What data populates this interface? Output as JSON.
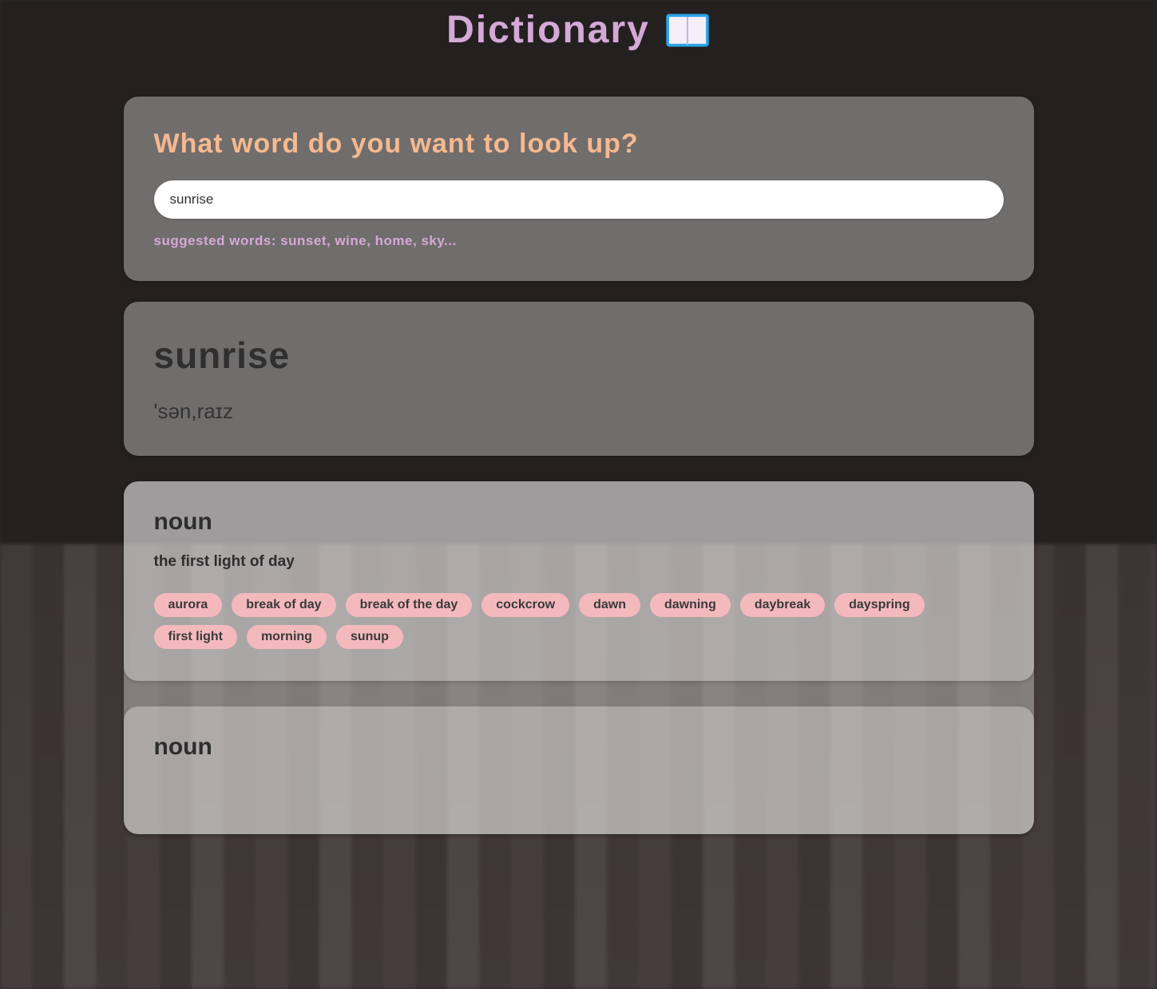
{
  "header": {
    "title": "Dictionary"
  },
  "search": {
    "prompt": "What word do you want to look up?",
    "value": "sunrise",
    "suggested_label": "suggested words: sunset, wine, home, sky..."
  },
  "result": {
    "word": "sunrise",
    "phonetic": "'sən,raɪz"
  },
  "definitions": [
    {
      "part_of_speech": "noun",
      "text": "the first light of day",
      "synonyms": [
        "aurora",
        "break of day",
        "break of the day",
        "cockcrow",
        "dawn",
        "dawning",
        "daybreak",
        "dayspring",
        "first light",
        "morning",
        "sunup"
      ]
    },
    {
      "part_of_speech": "noun",
      "text": "",
      "synonyms": []
    }
  ]
}
